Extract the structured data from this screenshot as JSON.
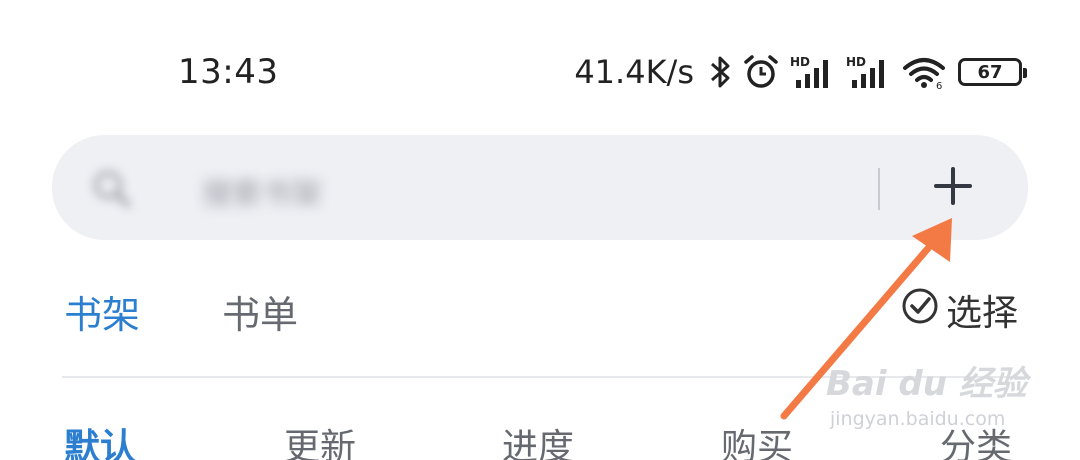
{
  "status_bar": {
    "time": "13:43",
    "net_speed": "41.4K/s",
    "battery": "67",
    "icons": [
      "bluetooth-icon",
      "alarm-icon",
      "hd-signal-icon",
      "hd-signal-icon",
      "wifi-icon",
      "battery-icon"
    ]
  },
  "search": {
    "placeholder": "搜索书架",
    "icon": "search-icon",
    "add_icon": "plus-icon"
  },
  "tabs": {
    "bookshelf": "书架",
    "booklist": "书单",
    "select_label": "选择"
  },
  "filters": [
    "默认",
    "更新",
    "进度",
    "购买",
    "分类"
  ],
  "watermark": {
    "text": "Bai du 经验",
    "sub": "jingyan.baidu.com"
  },
  "colors": {
    "accent": "#2c7fd0",
    "search_bg": "#eff0f4",
    "annotation_arrow": "#f47a45"
  }
}
